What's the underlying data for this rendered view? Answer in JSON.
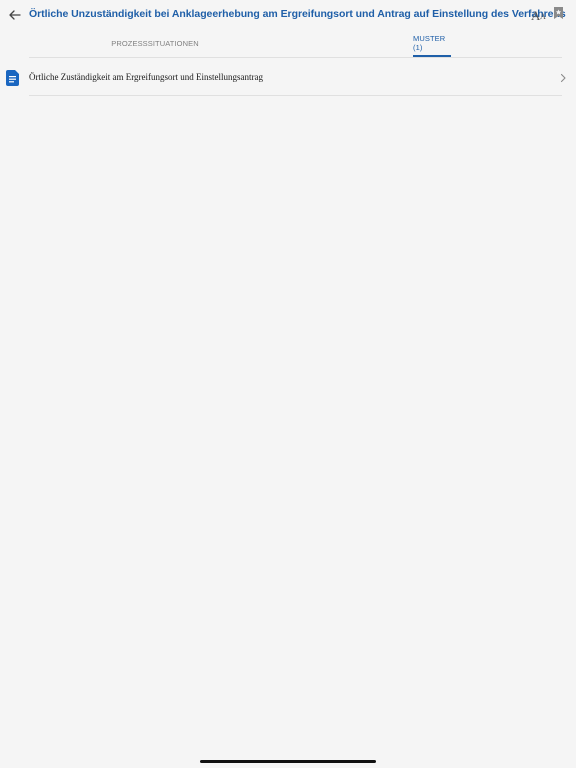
{
  "header": {
    "title": "Örtliche Unzuständigkeit bei Anklageerhebung am Ergreifungsort und Antrag auf Einstellung des Verfahrens",
    "back_icon": "arrow-left-icon",
    "font_size_icon": "font-size-icon",
    "font_size_big": "A",
    "font_size_small": "A",
    "bookmark_icon": "bookmark-icon"
  },
  "tabs": [
    {
      "label": "PROZESSSITUATIONEN",
      "active": false
    },
    {
      "label": "MUSTER (1)",
      "active": true
    }
  ],
  "list": {
    "items": [
      {
        "icon": "document-icon",
        "label": "Örtliche Zuständigkeit am Ergreifungsort und Einstellungsantrag",
        "chevron": "chevron-right-icon"
      }
    ]
  },
  "colors": {
    "accent": "#1f5fa8",
    "icon_blue": "#1a66c0",
    "background": "#f5f5f5",
    "divider": "#e0e0e0",
    "inactive_tab": "#808080"
  }
}
